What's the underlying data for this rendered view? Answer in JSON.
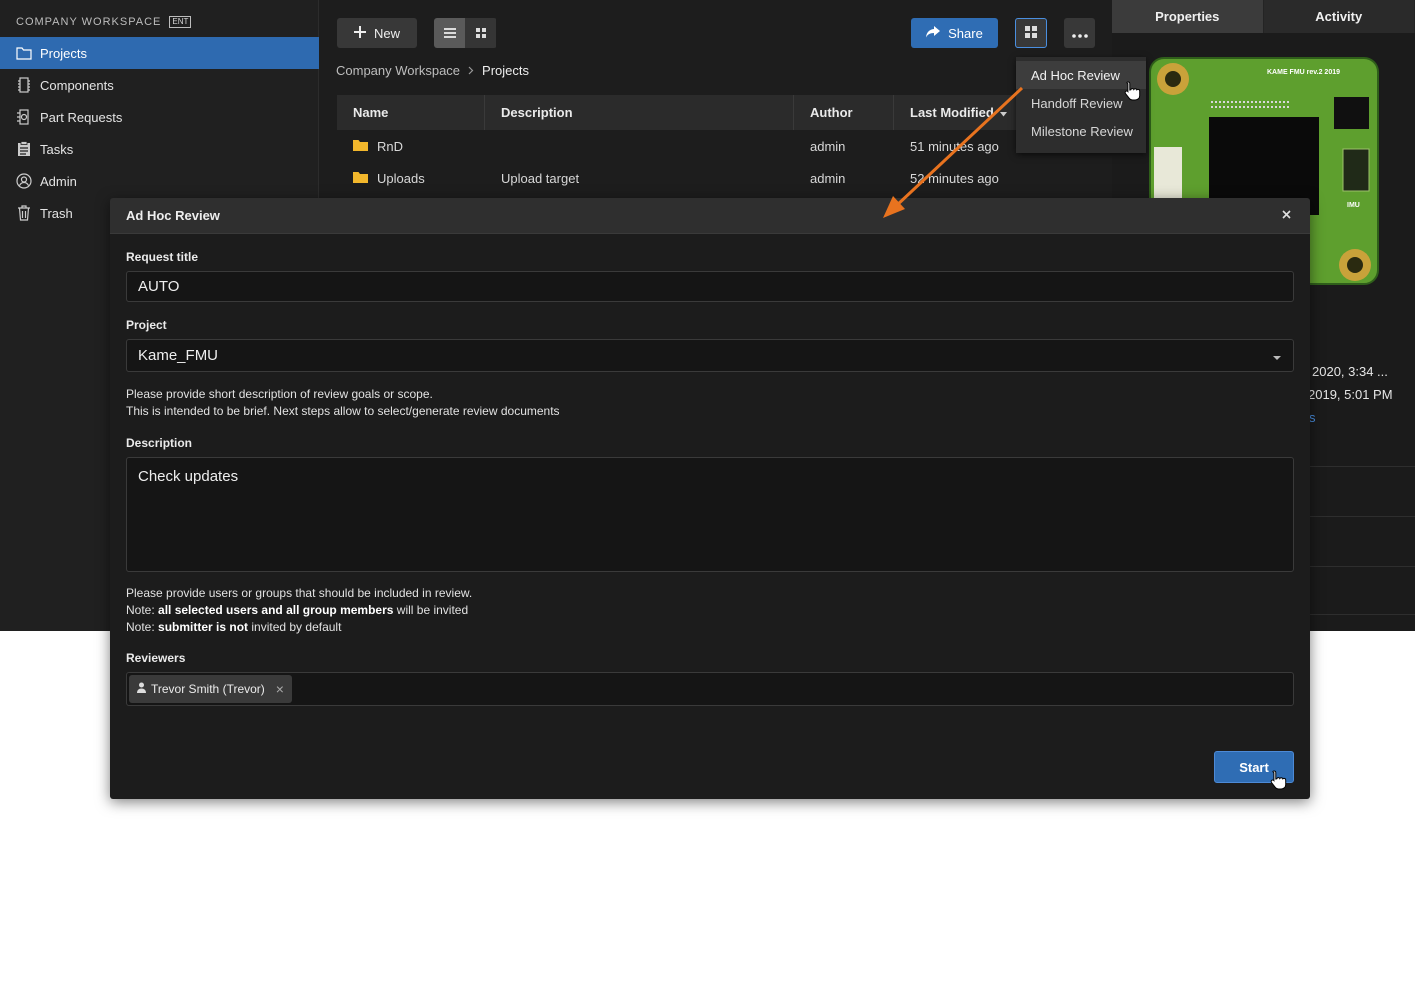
{
  "sidebar": {
    "workspace_title": "COMPANY WORKSPACE",
    "badge": "ENT",
    "items": [
      {
        "label": "Projects",
        "icon": "folder-icon",
        "active": true
      },
      {
        "label": "Components",
        "icon": "component-icon",
        "active": false
      },
      {
        "label": "Part Requests",
        "icon": "part-request-icon",
        "active": false
      },
      {
        "label": "Tasks",
        "icon": "clipboard-icon",
        "active": false
      },
      {
        "label": "Admin",
        "icon": "user-circle-icon",
        "active": false
      },
      {
        "label": "Trash",
        "icon": "trash-icon",
        "active": false
      }
    ]
  },
  "toolbar": {
    "new_label": "New",
    "share_label": "Share"
  },
  "breadcrumb": {
    "root": "Company Workspace",
    "current": "Projects"
  },
  "table": {
    "columns": [
      "Name",
      "Description",
      "Author",
      "Last Modified"
    ],
    "rows": [
      {
        "name": "RnD",
        "description": "",
        "author": "admin",
        "modified": "51 minutes ago"
      },
      {
        "name": "Uploads",
        "description": "Upload target",
        "author": "admin",
        "modified": "52 minutes ago"
      }
    ]
  },
  "dropdown": {
    "items": [
      "Ad Hoc Review",
      "Handoff Review",
      "Milestone Review"
    ]
  },
  "right_panel": {
    "tabs": [
      "Properties",
      "Activity"
    ],
    "board_label": "KAME FMU rev.2 2019",
    "imu_label": "IMU",
    "date1": "2020, 3:34 ...",
    "date2": "2019, 5:01 PM",
    "link_fragment": "s"
  },
  "modal": {
    "title": "Ad Hoc Review",
    "request_title_label": "Request title",
    "request_title_value": "AUTO",
    "project_label": "Project",
    "project_value": "Kame_FMU",
    "desc_help_1": "Please provide short description of review goals or scope.",
    "desc_help_2": "This is intended to be brief. Next steps allow to select/generate review documents",
    "description_label": "Description",
    "description_value": "Check updates",
    "reviewers_help_1": "Please provide users or groups that should be included in review.",
    "note1_prefix": "Note: ",
    "note1_bold": "all selected users and all group members",
    "note1_suffix": " will be invited",
    "note2_prefix": "Note: ",
    "note2_bold": "submitter is not",
    "note2_suffix": " invited by default",
    "reviewers_label": "Reviewers",
    "reviewer_chip": "Trevor Smith (Trevor)",
    "start_label": "Start"
  },
  "colors": {
    "accent": "#2f6db4",
    "annotation_arrow": "#e8731f",
    "background": "#1d1d1d"
  }
}
